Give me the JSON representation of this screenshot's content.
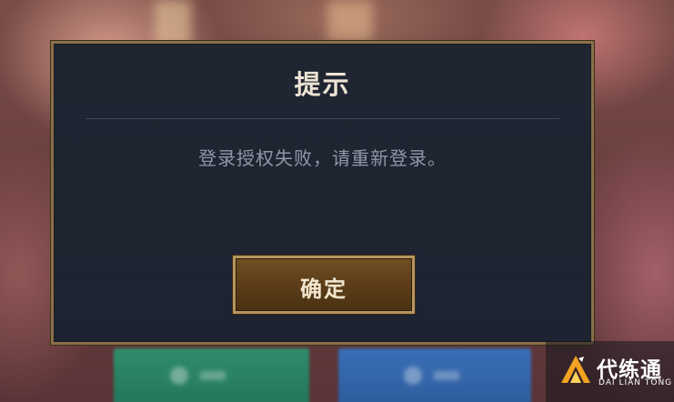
{
  "dialog": {
    "title": "提示",
    "message": "登录授权失败，请重新登录。",
    "confirm_label": "确定"
  },
  "watermark": {
    "name": "代练通",
    "subtitle": "DAI LIAN TONG"
  },
  "colors": {
    "dialog_bg": "#1f2431",
    "border_gold": "#8a7048",
    "button_brown": "#5a3c17",
    "title_text": "#ece4d3",
    "message_text": "#9097a5",
    "logo_orange": "#f3a321"
  }
}
